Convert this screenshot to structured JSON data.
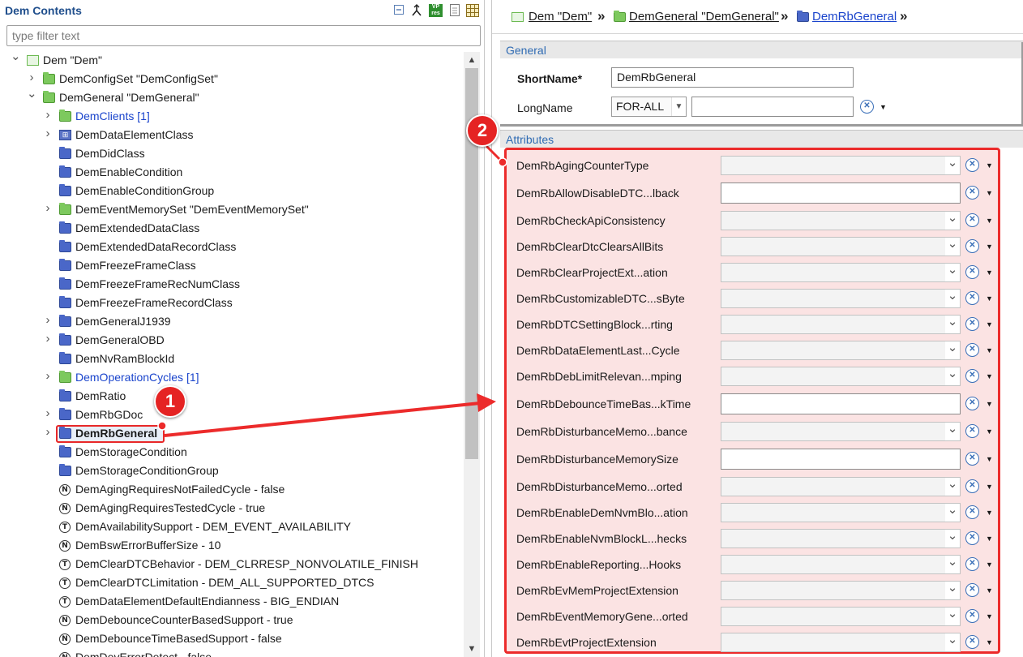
{
  "left": {
    "title": "Dem Contents",
    "filter_placeholder": "type filter text",
    "toolbar": [
      "collapse-all-icon",
      "link-with-editor-icon",
      "vp-res-icon",
      "document-icon",
      "table-grid-icon"
    ],
    "tree": [
      {
        "label": "Dem \"Dem\"",
        "icon": "module-icon",
        "twisty": "expanded"
      },
      {
        "label": "DemConfigSet \"DemConfigSet\"",
        "icon": "folder-green-icon",
        "twisty": "collapsed"
      },
      {
        "label": "DemGeneral \"DemGeneral\"",
        "icon": "folder-green-icon",
        "twisty": "expanded"
      },
      {
        "label": "DemClients [1]",
        "icon": "folder-green-icon",
        "twisty": "collapsed",
        "style": "link"
      },
      {
        "label": "DemDataElementClass",
        "icon": "data-class-icon",
        "twisty": "collapsed"
      },
      {
        "label": "DemDidClass",
        "icon": "folder-blue-icon",
        "twisty": "none"
      },
      {
        "label": "DemEnableCondition",
        "icon": "folder-blue-icon",
        "twisty": "none"
      },
      {
        "label": "DemEnableConditionGroup",
        "icon": "folder-blue-icon",
        "twisty": "none"
      },
      {
        "label": "DemEventMemorySet \"DemEventMemorySet\"",
        "icon": "folder-green-icon",
        "twisty": "collapsed"
      },
      {
        "label": "DemExtendedDataClass",
        "icon": "folder-blue-icon",
        "twisty": "none"
      },
      {
        "label": "DemExtendedDataRecordClass",
        "icon": "folder-blue-icon",
        "twisty": "none"
      },
      {
        "label": "DemFreezeFrameClass",
        "icon": "folder-blue-icon",
        "twisty": "none"
      },
      {
        "label": "DemFreezeFrameRecNumClass",
        "icon": "folder-blue-icon",
        "twisty": "none"
      },
      {
        "label": "DemFreezeFrameRecordClass",
        "icon": "folder-blue-icon",
        "twisty": "none"
      },
      {
        "label": "DemGeneralJ1939",
        "icon": "folder-blue-icon",
        "twisty": "collapsed"
      },
      {
        "label": "DemGeneralOBD",
        "icon": "folder-blue-icon",
        "twisty": "collapsed"
      },
      {
        "label": "DemNvRamBlockId",
        "icon": "folder-blue-icon",
        "twisty": "none"
      },
      {
        "label": "DemOperationCycles [1]",
        "icon": "folder-green-icon",
        "twisty": "collapsed",
        "style": "link"
      },
      {
        "label": "DemRatio",
        "icon": "folder-blue-icon",
        "twisty": "none"
      },
      {
        "label": "DemRbGDoc",
        "icon": "folder-blue-icon",
        "twisty": "collapsed"
      },
      {
        "label": "DemRbGeneral",
        "icon": "folder-blue-icon",
        "twisty": "collapsed",
        "style": "selected"
      },
      {
        "label": "DemStorageCondition",
        "icon": "folder-blue-icon",
        "twisty": "none"
      },
      {
        "label": "DemStorageConditionGroup",
        "icon": "folder-blue-icon",
        "twisty": "none"
      },
      {
        "label": "DemAgingRequiresNotFailedCycle - false",
        "icon": "param-n-icon",
        "glyph": "N",
        "twisty": "none"
      },
      {
        "label": "DemAgingRequiresTestedCycle - true",
        "icon": "param-n-icon",
        "glyph": "N",
        "twisty": "none"
      },
      {
        "label": "DemAvailabilitySupport - DEM_EVENT_AVAILABILITY",
        "icon": "param-t-icon",
        "glyph": "T",
        "twisty": "none"
      },
      {
        "label": "DemBswErrorBufferSize - 10",
        "icon": "param-n-icon",
        "glyph": "N",
        "twisty": "none"
      },
      {
        "label": "DemClearDTCBehavior - DEM_CLRRESP_NONVOLATILE_FINISH",
        "icon": "param-t-icon",
        "glyph": "T",
        "twisty": "none"
      },
      {
        "label": "DemClearDTCLimitation - DEM_ALL_SUPPORTED_DTCS",
        "icon": "param-t-icon",
        "glyph": "T",
        "twisty": "none"
      },
      {
        "label": "DemDataElementDefaultEndianness - BIG_ENDIAN",
        "icon": "param-t-icon",
        "glyph": "T",
        "twisty": "none"
      },
      {
        "label": "DemDebounceCounterBasedSupport - true",
        "icon": "param-n-icon",
        "glyph": "N",
        "twisty": "none"
      },
      {
        "label": "DemDebounceTimeBasedSupport - false",
        "icon": "param-n-icon",
        "glyph": "N",
        "twisty": "none"
      },
      {
        "label": "DemDevErrorDetect - false",
        "icon": "param-n-icon",
        "glyph": "N",
        "twisty": "none"
      }
    ]
  },
  "breadcrumb": [
    {
      "label": "Dem \"Dem\"",
      "icon": "module-icon"
    },
    {
      "label": "DemGeneral \"DemGeneral\"",
      "icon": "folder-green-icon"
    },
    {
      "label": "DemRbGeneral",
      "icon": "folder-blue-icon"
    }
  ],
  "general": {
    "section_label": "General",
    "shortname_label": "ShortName*",
    "shortname_value": "DemRbGeneral",
    "longname_label": "LongName",
    "longname_lang": "FOR-ALL",
    "longname_value": ""
  },
  "attributes": {
    "section_label": "Attributes",
    "rows": [
      {
        "label": "DemRbAgingCounterType",
        "kind": "combo"
      },
      {
        "label": "DemRbAllowDisableDTC...lback",
        "kind": "text"
      },
      {
        "label": "DemRbCheckApiConsistency",
        "kind": "combo"
      },
      {
        "label": "DemRbClearDtcClearsAllBits",
        "kind": "combo"
      },
      {
        "label": "DemRbClearProjectExt...ation",
        "kind": "combo"
      },
      {
        "label": "DemRbCustomizableDTC...sByte",
        "kind": "combo"
      },
      {
        "label": "DemRbDTCSettingBlock...rting",
        "kind": "combo"
      },
      {
        "label": "DemRbDataElementLast...Cycle",
        "kind": "combo"
      },
      {
        "label": "DemRbDebLimitRelevan...mping",
        "kind": "combo"
      },
      {
        "label": "DemRbDebounceTimeBas...kTime",
        "kind": "text"
      },
      {
        "label": "DemRbDisturbanceMemo...bance",
        "kind": "combo"
      },
      {
        "label": "DemRbDisturbanceMemorySize",
        "kind": "text"
      },
      {
        "label": "DemRbDisturbanceMemo...orted",
        "kind": "combo"
      },
      {
        "label": "DemRbEnableDemNvmBlo...ation",
        "kind": "combo"
      },
      {
        "label": "DemRbEnableNvmBlockL...hecks",
        "kind": "combo"
      },
      {
        "label": "DemRbEnableReporting...Hooks",
        "kind": "combo"
      },
      {
        "label": "DemRbEvMemProjectExtension",
        "kind": "combo"
      },
      {
        "label": "DemRbEventMemoryGene...orted",
        "kind": "combo"
      },
      {
        "label": "DemRbEvtProjectExtension",
        "kind": "combo"
      }
    ]
  },
  "callouts": [
    "1",
    "2"
  ],
  "colors": {
    "accent_red": "#e52323",
    "title_blue": "#1f4e8c",
    "link_blue": "#1a44cc",
    "highlight_fill": "#fbe3e3"
  }
}
